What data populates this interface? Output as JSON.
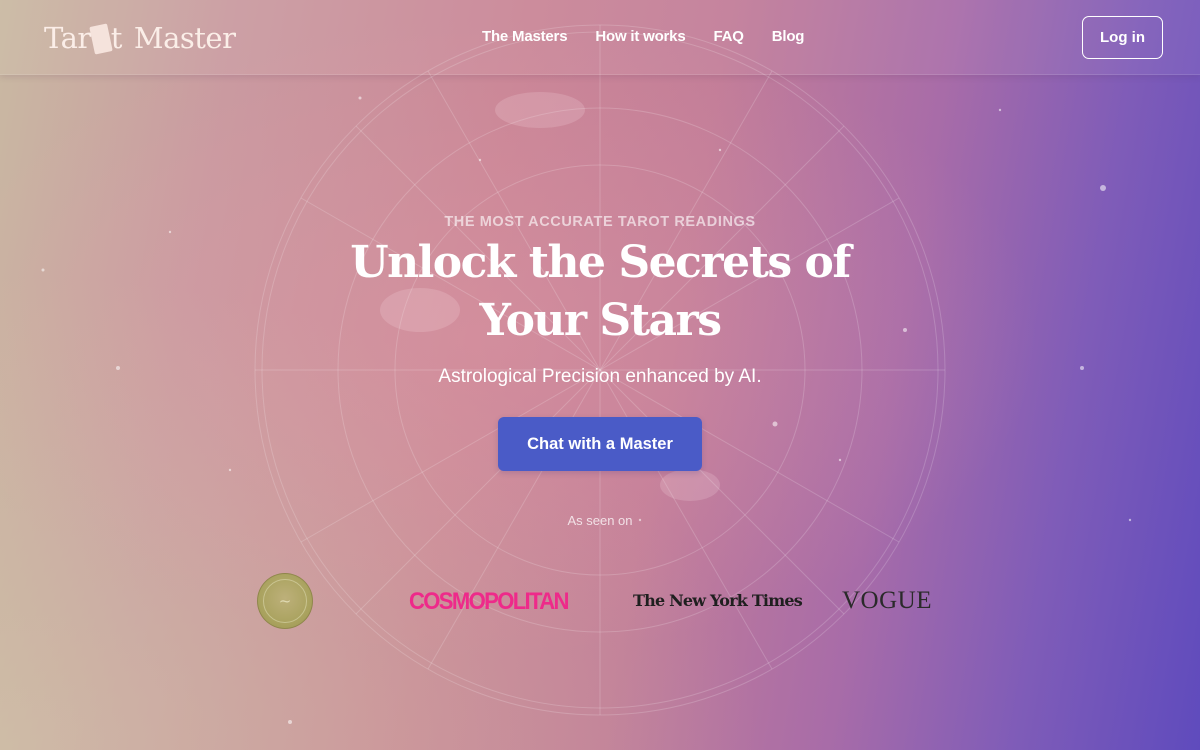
{
  "brand": {
    "logo_text_1": "Tar",
    "logo_text_2": "t",
    "logo_text_3": "Master"
  },
  "nav": {
    "items": [
      {
        "label": "The Masters"
      },
      {
        "label": "How it works"
      },
      {
        "label": "FAQ"
      },
      {
        "label": "Blog"
      }
    ],
    "login_label": "Log in"
  },
  "hero": {
    "eyebrow": "THE MOST ACCURATE TAROT READINGS",
    "headline_line1": "Unlock the Secrets of",
    "headline_line2": "Your Stars",
    "subtitle": "Astrological Precision enhanced by AI.",
    "cta_label": "Chat with a Master"
  },
  "press": {
    "heading": "As seen on",
    "logos": [
      {
        "name": "badge-logo",
        "text": ""
      },
      {
        "name": "cosmopolitan-logo",
        "text": "COSMOPOLITAN"
      },
      {
        "name": "nyt-logo",
        "text": "The New York Times"
      },
      {
        "name": "vogue-logo",
        "text": "VOGUE"
      }
    ]
  },
  "colors": {
    "cta": "#4a5bc7",
    "cosmopolitan": "#ee2a8a",
    "text": "#ffffff"
  }
}
